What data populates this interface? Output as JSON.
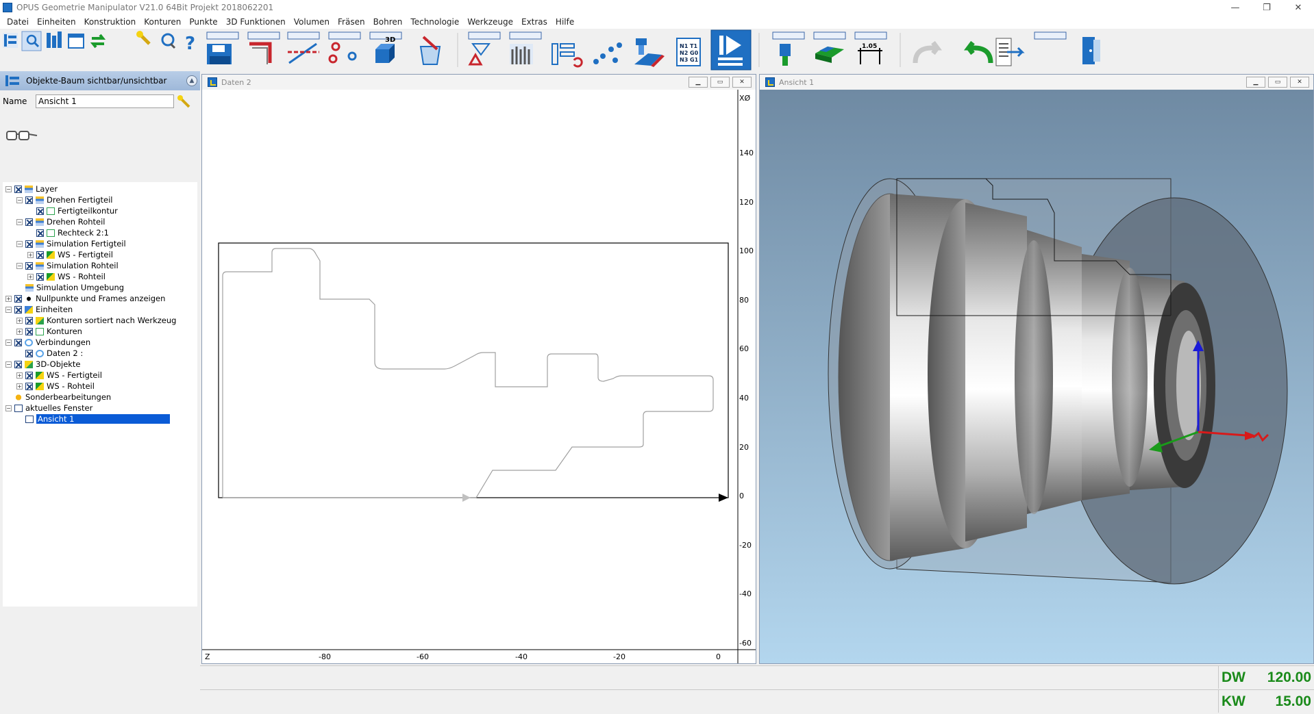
{
  "window": {
    "title": "OPUS Geometrie Manipulator V21.0 64Bit  Projekt 2018062201",
    "controls": [
      "—",
      "❐",
      "✕"
    ]
  },
  "menu": [
    "Datei",
    "Einheiten",
    "Konstruktion",
    "Konturen",
    "Punkte",
    "3D Funktionen",
    "Volumen",
    "Fräsen",
    "Bohren",
    "Technologie",
    "Werkzeuge",
    "Extras",
    "Hilfe"
  ],
  "toolbar": {
    "nc_labels": [
      "N1 T1",
      "N2 G0",
      "N3 G1"
    ],
    "scale_label": "1.05",
    "badge_3d": "3D"
  },
  "leftpanel": {
    "header": "Objekte-Baum sichtbar/unsichtbar",
    "name_label": "Name",
    "name_value": "Ansicht 1",
    "tree": [
      {
        "label": "Layer",
        "level": 0,
        "exp": "−",
        "chk": true,
        "icon": "ico-layer"
      },
      {
        "label": "Drehen Fertigteil",
        "level": 1,
        "exp": "−",
        "chk": true,
        "icon": "ico-layer"
      },
      {
        "label": "Fertigteilkontur",
        "level": 2,
        "exp": "",
        "chk": true,
        "icon": "ico-contour"
      },
      {
        "label": "Drehen Rohteil",
        "level": 1,
        "exp": "−",
        "chk": true,
        "icon": "ico-layer"
      },
      {
        "label": "Rechteck 2:1",
        "level": 2,
        "exp": "",
        "chk": true,
        "icon": "ico-contour"
      },
      {
        "label": "Simulation Fertigteil",
        "level": 1,
        "exp": "−",
        "chk": true,
        "icon": "ico-layer"
      },
      {
        "label": "WS - Fertigteil",
        "level": 2,
        "exp": "+",
        "chk": true,
        "icon": "ico-ws"
      },
      {
        "label": "Simulation Rohteil",
        "level": 1,
        "exp": "−",
        "chk": true,
        "icon": "ico-layer"
      },
      {
        "label": "WS - Rohteil",
        "level": 2,
        "exp": "+",
        "chk": true,
        "icon": "ico-ws"
      },
      {
        "label": "Simulation Umgebung",
        "level": 1,
        "exp": "",
        "chk": false,
        "icon": "ico-layer"
      },
      {
        "label": "Nullpunkte und Frames anzeigen",
        "level": 0,
        "exp": "+",
        "chk": true,
        "icon": "ico-null"
      },
      {
        "label": "Einheiten",
        "level": 0,
        "exp": "−",
        "chk": true,
        "icon": "ico-unit"
      },
      {
        "label": "Konturen sortiert nach Werkzeug",
        "level": 1,
        "exp": "+",
        "chk": true,
        "icon": "ico-3d"
      },
      {
        "label": "Konturen",
        "level": 1,
        "exp": "+",
        "chk": true,
        "icon": "ico-contour"
      },
      {
        "label": "Verbindungen",
        "level": 0,
        "exp": "−",
        "chk": true,
        "icon": "ico-conn"
      },
      {
        "label": "Daten 2 :",
        "level": 1,
        "exp": "",
        "chk": true,
        "icon": "ico-conn"
      },
      {
        "label": "3D-Objekte",
        "level": 0,
        "exp": "−",
        "chk": true,
        "icon": "ico-3d"
      },
      {
        "label": "WS - Fertigteil",
        "level": 1,
        "exp": "+",
        "chk": true,
        "icon": "ico-ws"
      },
      {
        "label": "WS - Rohteil",
        "level": 1,
        "exp": "+",
        "chk": true,
        "icon": "ico-ws"
      },
      {
        "label": "Sonderbearbeitungen",
        "level": 0,
        "exp": "",
        "chk": false,
        "icon": "ico-special"
      },
      {
        "label": "aktuelles Fenster",
        "level": 0,
        "exp": "−",
        "chk": false,
        "icon": "ico-win"
      },
      {
        "label": "Ansicht 1",
        "level": 1,
        "exp": "",
        "chk": false,
        "icon": "ico-win",
        "selected": true
      }
    ]
  },
  "daten2": {
    "title": "Daten 2",
    "buttons": [
      "▁",
      "▭",
      "✕"
    ],
    "axis_x_label": "Z",
    "axis_y_label": "XØ",
    "x_ticks": [
      "-80",
      "-60",
      "-40",
      "-20",
      "0"
    ],
    "y_ticks": [
      "140",
      "120",
      "100",
      "80",
      "60",
      "40",
      "20",
      "0",
      "-20",
      "-40",
      "-60"
    ]
  },
  "ansicht1": {
    "title": "Ansicht 1",
    "buttons": [
      "▁",
      "▭",
      "✕"
    ]
  },
  "status": {
    "dw_label": "DW",
    "dw_value": "120.00",
    "kw_label": "KW",
    "kw_value": "15.00"
  },
  "colors": {
    "accent": "#1f6fc2",
    "readout": "#1a8a1a",
    "selection": "#0a5bd6",
    "viewport_top": "#6f8aa3",
    "viewport_bottom": "#b3d6ee"
  }
}
